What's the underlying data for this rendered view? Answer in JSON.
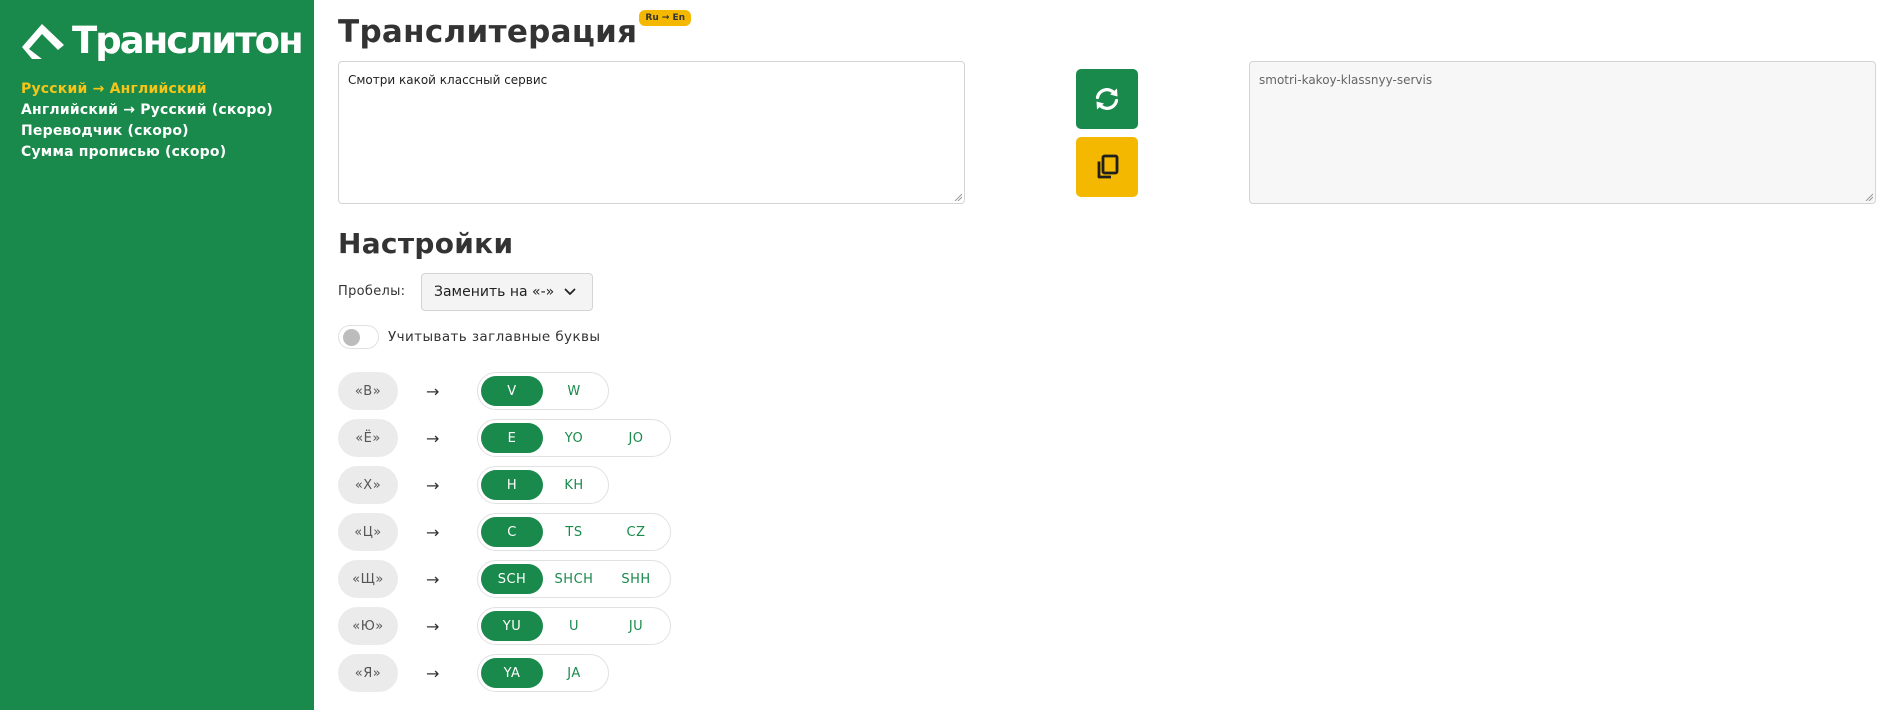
{
  "sidebar": {
    "logo_text": "Транслитон",
    "nav": [
      {
        "label": "Русский → Английский",
        "active": true
      },
      {
        "label": "Английский → Русский (скоро)",
        "active": false
      },
      {
        "label": "Переводчик (скоро)",
        "active": false
      },
      {
        "label": "Сумма прописью (скоро)",
        "active": false
      }
    ]
  },
  "main": {
    "title": "Транслитерация",
    "badge": "Ru → En",
    "input_text": "Смотри какой классный сервис",
    "output_text": "smotri-kakoy-klassnyy-servis",
    "refresh_icon": "refresh-icon",
    "copy_icon": "copy-icon"
  },
  "settings": {
    "title": "Настройки",
    "spaces_label": "Пробелы:",
    "spaces_value": "Заменить на «-»",
    "capitals_label": "Учитывать заглавные буквы",
    "capitals_enabled": false,
    "rules": [
      {
        "letter": "«В»",
        "options": [
          "V",
          "W"
        ],
        "selected": 0
      },
      {
        "letter": "«Ё»",
        "options": [
          "E",
          "YO",
          "JO"
        ],
        "selected": 0
      },
      {
        "letter": "«Х»",
        "options": [
          "H",
          "KH"
        ],
        "selected": 0
      },
      {
        "letter": "«Ц»",
        "options": [
          "C",
          "TS",
          "CZ"
        ],
        "selected": 0
      },
      {
        "letter": "«Щ»",
        "options": [
          "SCH",
          "SHCH",
          "SHH"
        ],
        "selected": 0
      },
      {
        "letter": "«Ю»",
        "options": [
          "YU",
          "U",
          "JU"
        ],
        "selected": 0
      },
      {
        "letter": "«Я»",
        "options": [
          "YA",
          "JA"
        ],
        "selected": 0
      }
    ],
    "arrow": "→"
  },
  "colors": {
    "brand_green": "#1a8a4c",
    "accent_yellow": "#f5b800",
    "active_nav": "#f5c518"
  }
}
